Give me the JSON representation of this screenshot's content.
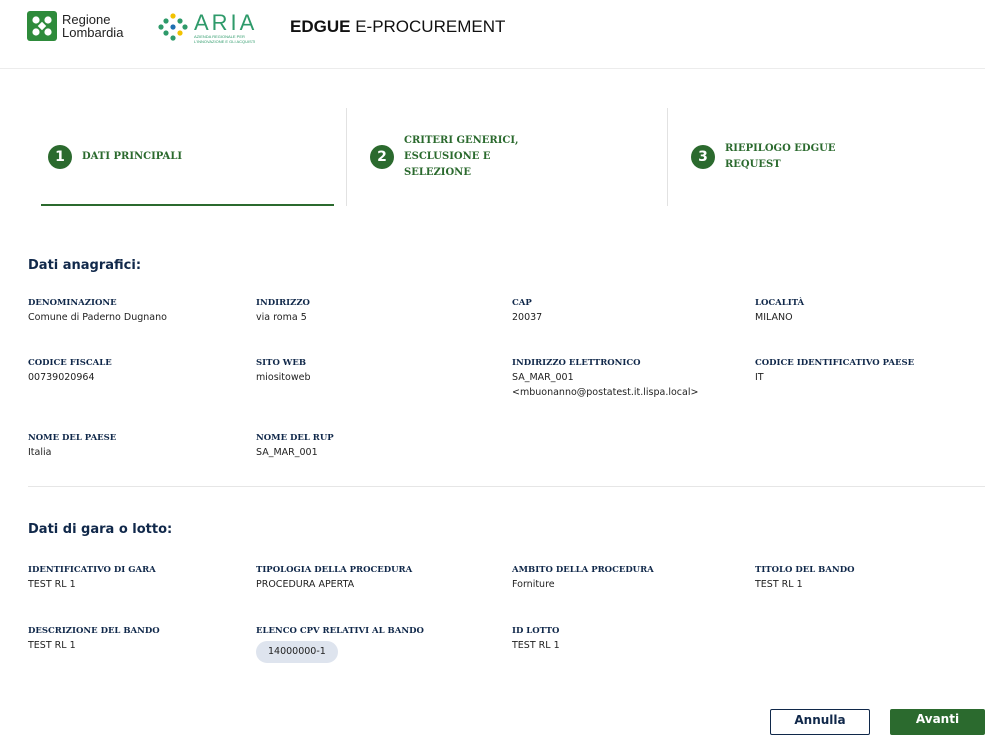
{
  "header": {
    "region_logo_line1": "Regione",
    "region_logo_line2": "Lombardia",
    "aria_logo_word": "ARIA",
    "aria_logo_sub": "AZIENDA REGIONALE PER L'INNOVAZIONE E GLI ACQUISTI",
    "app_title_bold": "EDGUE",
    "app_title_rest": " E-PROCUREMENT",
    "brand_green": "#2e8b3b",
    "aria_green": "#2e9a6a"
  },
  "steps": [
    {
      "number": "1",
      "label": "DATI PRINCIPALI",
      "active": true
    },
    {
      "number": "2",
      "label_lines": [
        "CRITERI GENERICI,",
        "ESCLUSIONE E",
        "SELEZIONE"
      ],
      "active": false
    },
    {
      "number": "3",
      "label_lines": [
        "RIEPILOGO EDGUE",
        "REQUEST"
      ],
      "active": false
    }
  ],
  "anagrafici": {
    "title": "Dati anagrafici:",
    "fields": [
      {
        "label": "DENOMINAZIONE",
        "value": "Comune di Paderno Dugnano"
      },
      {
        "label": "INDIRIZZO",
        "value": "via roma 5"
      },
      {
        "label": "CAP",
        "value": "20037"
      },
      {
        "label": "LOCALITÀ",
        "value": "MILANO"
      },
      {
        "label": "CODICE FISCALE",
        "value": "00739020964"
      },
      {
        "label": "SITO WEB",
        "value": "miositoweb"
      },
      {
        "label": "INDIRIZZO ELETTRONICO",
        "value": "SA_MAR_001",
        "value2": "<mbuonanno@postatest.it.lispa.local>"
      },
      {
        "label": "CODICE IDENTIFICATIVO PAESE",
        "value": "IT"
      },
      {
        "label": "NOME DEL PAESE",
        "value": "Italia"
      },
      {
        "label": "NOME DEL RUP",
        "value": "SA_MAR_001"
      }
    ]
  },
  "gara": {
    "title": "Dati di gara o lotto:",
    "fields": [
      {
        "label": "IDENTIFICATIVO DI GARA",
        "value": "TEST RL 1"
      },
      {
        "label": "TIPOLOGIA DELLA PROCEDURA",
        "value": "PROCEDURA APERTA"
      },
      {
        "label": "AMBITO DELLA PROCEDURA",
        "value": "Forniture"
      },
      {
        "label": "TITOLO DEL BANDO",
        "value": "TEST RL 1"
      },
      {
        "label": "DESCRIZIONE DEL BANDO",
        "value": "TEST RL 1"
      },
      {
        "label": "ELENCO CPV RELATIVI AL BANDO",
        "value": "14000000-1"
      },
      {
        "label": "ID LOTTO",
        "value": "TEST RL 1"
      }
    ]
  },
  "actions": {
    "cancel_label": "Annulla",
    "next_label": "Avanti"
  },
  "colors": {
    "accent_green": "#2b6a2e",
    "label_navy": "#10284a"
  }
}
